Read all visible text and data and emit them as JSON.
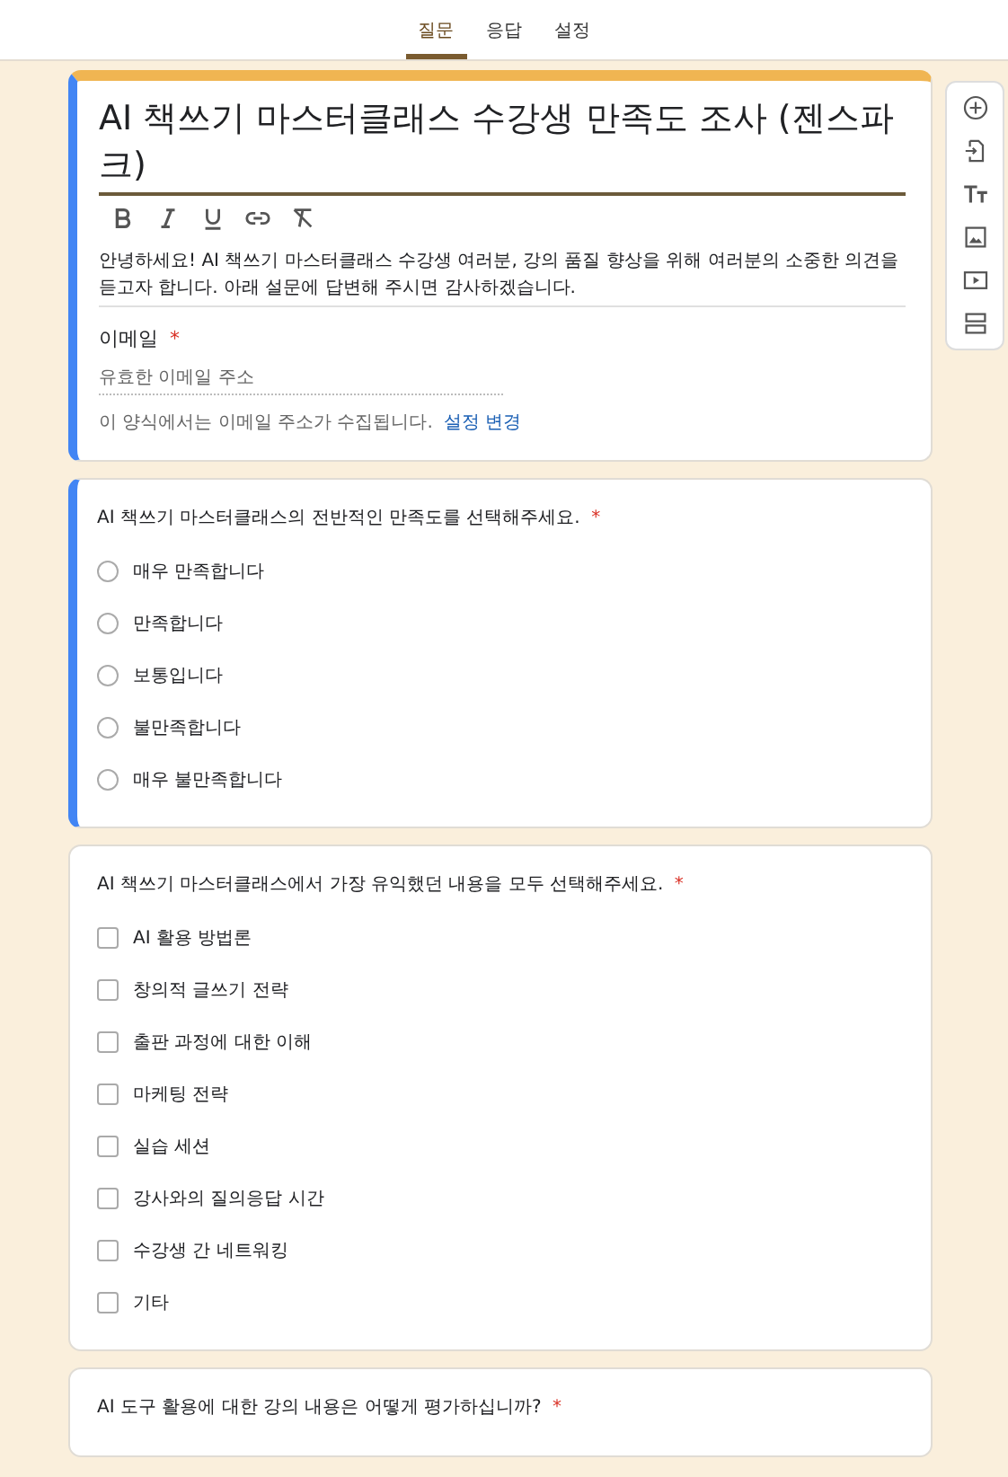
{
  "tabs": [
    {
      "label": "질문",
      "selected": true
    },
    {
      "label": "응답",
      "selected": false
    },
    {
      "label": "설정",
      "selected": false
    }
  ],
  "form": {
    "title": "AI 책쓰기 마스터클래스 수강생 만족도 조사 (젠스파크)",
    "description": "안녕하세요! AI 책쓰기 마스터클래스 수강생 여러분, 강의 품질 향상을 위해 여러분의 소중한 의견을 듣고자 합니다. 아래 설문에 답변해 주시면 감사하겠습니다.",
    "email_label": "이메일",
    "email_required_mark": "*",
    "email_placeholder": "유효한 이메일 주소",
    "email_note": "이 양식에서는 이메일 주소가 수집됩니다.",
    "email_link": "설정 변경"
  },
  "questions": [
    {
      "kind": "radio",
      "active": true,
      "required_mark": "*",
      "text": "AI 책쓰기 마스터클래스의 전반적인 만족도를 선택해주세요.",
      "options": [
        {
          "label": "매우 만족합니다",
          "selected": false
        },
        {
          "label": "만족합니다",
          "selected": false
        },
        {
          "label": "보통입니다",
          "selected": false
        },
        {
          "label": "불만족합니다",
          "selected": false
        },
        {
          "label": "매우 불만족합니다",
          "selected": false
        }
      ]
    },
    {
      "kind": "checkbox",
      "active": false,
      "required_mark": "*",
      "text": "AI 책쓰기 마스터클래스에서 가장 유익했던 내용을 모두 선택해주세요.",
      "options": [
        {
          "label": "AI 활용 방법론",
          "selected": false
        },
        {
          "label": "창의적 글쓰기 전략",
          "selected": false
        },
        {
          "label": "출판 과정에 대한 이해",
          "selected": false
        },
        {
          "label": "마케팅 전략",
          "selected": false
        },
        {
          "label": "실습 세션",
          "selected": false
        },
        {
          "label": "강사와의 질의응답 시간",
          "selected": false
        },
        {
          "label": "수강생 간 네트워킹",
          "selected": false
        },
        {
          "label": "기타",
          "selected": false
        }
      ]
    },
    {
      "active": false,
      "required_mark": "*",
      "text": "AI 도구 활용에 대한 강의 내용은 어떻게 평가하십니까?"
    }
  ]
}
